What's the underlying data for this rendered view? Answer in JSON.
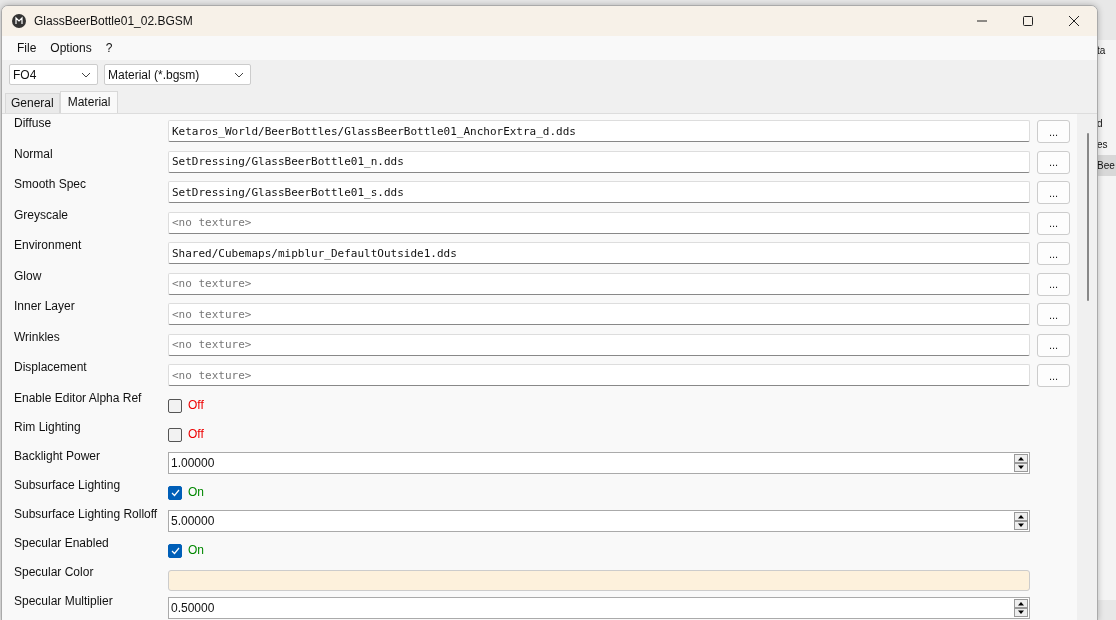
{
  "background_fragments": [
    "ta",
    "d",
    "es",
    "Bee"
  ],
  "window": {
    "title": "GlassBeerBottle01_02.BGSM"
  },
  "menu": [
    "File",
    "Options",
    "?"
  ],
  "selectors": [
    {
      "value": "FO4"
    },
    {
      "value": "Material (*.bgsm)"
    }
  ],
  "tabs": [
    {
      "label": "General",
      "selected": false
    },
    {
      "label": "Material",
      "selected": true
    }
  ],
  "properties": [
    {
      "kind": "texture",
      "label": "Diffuse",
      "value": "Ketaros_World/BeerBottles/GlassBeerBottle01_AnchorExtra_d.dds",
      "button": "..."
    },
    {
      "kind": "texture",
      "label": "Normal",
      "value": "SetDressing/GlassBeerBottle01_n.dds",
      "button": "..."
    },
    {
      "kind": "texture",
      "label": "Smooth Spec",
      "value": "SetDressing/GlassBeerBottle01_s.dds",
      "button": "..."
    },
    {
      "kind": "texture",
      "label": "Greyscale",
      "placeholder": "<no texture>",
      "button": "..."
    },
    {
      "kind": "texture",
      "label": "Environment",
      "value": "Shared/Cubemaps/mipblur_DefaultOutside1.dds",
      "button": "..."
    },
    {
      "kind": "texture",
      "label": "Glow",
      "placeholder": "<no texture>",
      "button": "..."
    },
    {
      "kind": "texture",
      "label": "Inner Layer",
      "placeholder": "<no texture>",
      "button": "..."
    },
    {
      "kind": "texture",
      "label": "Wrinkles",
      "placeholder": "<no texture>",
      "button": "..."
    },
    {
      "kind": "texture",
      "label": "Displacement",
      "placeholder": "<no texture>",
      "button": "..."
    },
    {
      "kind": "toggle",
      "label": "Enable Editor Alpha Ref",
      "checked": false,
      "state_text": "Off"
    },
    {
      "kind": "toggle",
      "label": "Rim Lighting",
      "checked": false,
      "state_text": "Off"
    },
    {
      "kind": "number",
      "label": "Backlight Power",
      "value": "1.00000"
    },
    {
      "kind": "toggle",
      "label": "Subsurface Lighting",
      "checked": true,
      "state_text": "On"
    },
    {
      "kind": "number",
      "label": "Subsurface Lighting Rolloff",
      "value": "5.00000"
    },
    {
      "kind": "toggle",
      "label": "Specular Enabled",
      "checked": true,
      "state_text": "On"
    },
    {
      "kind": "color",
      "label": "Specular Color",
      "color": "#fdf1dc"
    },
    {
      "kind": "number",
      "label": "Specular Multiplier",
      "value": "0.50000"
    }
  ]
}
